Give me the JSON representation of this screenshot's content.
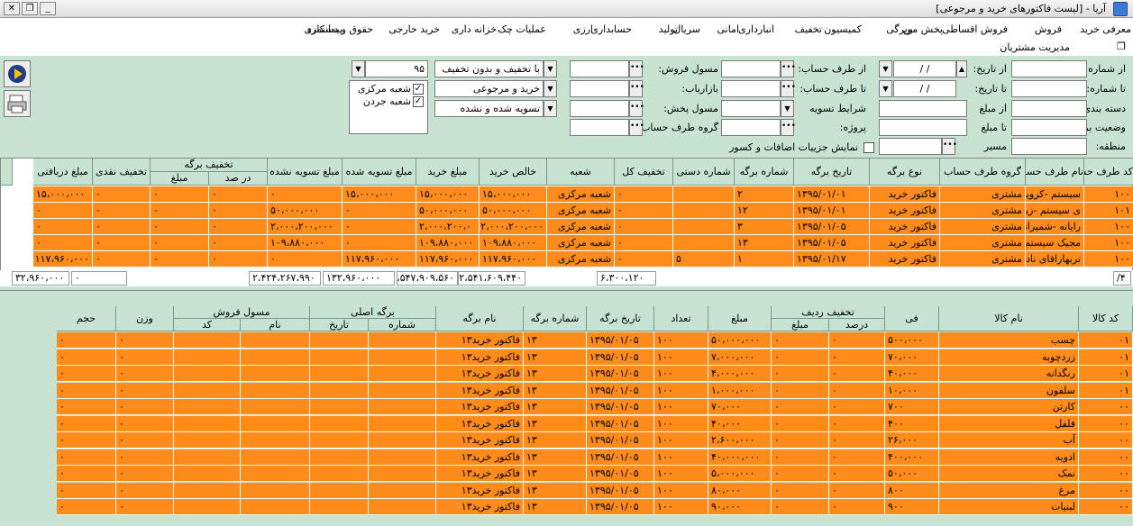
{
  "window": {
    "title": "آریا - [لیست فاکتورهای خرید و مرجوعی]",
    "min": "_",
    "restore": "❐",
    "close": "✕"
  },
  "menu": [
    "معرفی",
    "خرید",
    "فروش",
    "فروش اقساطی",
    "پخش مویرگی",
    "بن",
    "کمیسیون",
    "تخفیف",
    "انبارداری",
    "امانی",
    "سریال",
    "تولید",
    "حسابداری",
    "ارزی",
    "عملیات چک",
    "خزانه داری",
    "خرید خارجی",
    "حقوق و دستمزد",
    "پیمانکاری"
  ],
  "submenu": {
    "label": "مدیریت مشتریان",
    "icon": "❐"
  },
  "filters": {
    "from_number": "از شماره:",
    "to_number": "تا شماره:",
    "category": "دسته بندی:",
    "sheet_status": "وضعیت برگه",
    "region": "منطقه:",
    "from_date": "از تاریخ:",
    "to_date": "تا تاریخ:",
    "date_sep": "/   /",
    "from_amount": "از مبلغ",
    "to_amount": "تا مبلغ",
    "route": "مسیر",
    "from_account": "از طرف حساب:",
    "to_account": "تا طرف حساب:",
    "settlement": "شرایط تسویه",
    "project": "پروژه:",
    "sales_officer": "مسول فروش:",
    "marketer": "بازاریاب:",
    "dist_officer": "مسول پخش:",
    "account_group": "گروه طرف حساب",
    "show_details": "نمایش جزییات اضافات و کسور",
    "discount_sel": "با تخفیف و بدون تخفیف",
    "type_sel": "خرید و مرجوعی",
    "settle_sel": "تسویه شده و نشده",
    "year": "۹۵",
    "branch1": "شعبه مرکزی",
    "branch2": "شعبه جردن"
  },
  "top_headers": {
    "account_code": "کد طرف حساب",
    "account_name": "نام طرف حساب",
    "account_group": "گروه طرف حساب",
    "sheet_type": "نوع برگه",
    "sheet_date": "تاریخ برگه",
    "sheet_no": "شماره برگه",
    "manual_no": "شماره دستی",
    "total_discount": "تخفیف کل",
    "branch": "شعبه",
    "net_purchase": "خالص خرید",
    "purchase_amount": "مبلغ خرید",
    "settled_amount": "مبلغ تسویه شده",
    "unsettled_amount": "مبلغ تسویه نشده",
    "sheet_discount": "تخفیف برگه",
    "percent": "در صد",
    "amount": "مبلغ",
    "cash_discount": "تخفیف نقدی",
    "received_amount": "مبلغ دریافتی"
  },
  "top_rows": [
    {
      "code": "۱۰۰",
      "name": "سیستم -کرویی",
      "group": "مشتری",
      "type": "فاکتور خرید",
      "date": "۱۳۹۵/۰۱/۰۱",
      "no": "۲",
      "manual": "",
      "tdisc": "۰",
      "branch": "شعبه مرکزی",
      "net": "۱۵،۰۰۰،۰۰۰",
      "purchase": "۱۵،۰۰۰،۰۰۰",
      "settled": "۱۵،۰۰۰،۰۰۰",
      "unsettled": "۰",
      "pct": "۰",
      "amt": "۰",
      "cash": "۰",
      "received": "۱۵،۰۰۰،۰۰۰"
    },
    {
      "code": "۱۰۱",
      "name": "ی سیستم -زیان",
      "group": "مشتری",
      "type": "فاکتور خرید",
      "date": "۱۳۹۵/۰۱/۰۱",
      "no": "۱۲",
      "manual": "",
      "tdisc": "۰",
      "branch": "شعبه مرکزی",
      "net": "۵۰،۰۰۰،۰۰۰",
      "purchase": "۵۰،۰۰۰،۰۰۰",
      "settled": "۰",
      "unsettled": "۵۰،۰۰۰،۰۰۰",
      "pct": "۰",
      "amt": "۰",
      "cash": "۰",
      "received": "۰"
    },
    {
      "code": "۱۰۰",
      "name": "رایانه -شمیرانی",
      "group": "مشتری",
      "type": "فاکتور خرید",
      "date": "۱۳۹۵/۰۱/۰۵",
      "no": "۳",
      "manual": "",
      "tdisc": "۰",
      "branch": "شعبه مرکزی",
      "net": "۲،۰۰۰،۲۰۰،۰۰۰",
      "purchase": "۲،۰۰۰،۲۰۰،۰",
      "settled": "۰",
      "unsettled": "۲،۰۰۰،۲۰۰،۰۰۰",
      "pct": "۰",
      "amt": "۰",
      "cash": "۰",
      "received": "۰"
    },
    {
      "code": "۱۰۰",
      "name": "مجیک سیستم",
      "group": "مشتری",
      "type": "فاکتور خرید",
      "date": "۱۳۹۵/۰۱/۰۵",
      "no": "۱۳",
      "manual": "",
      "tdisc": "۰",
      "branch": "شعبه مرکزی",
      "net": "۱۰۹،۸۸۰،۰۰۰",
      "purchase": "۱۰۹،۸۸۰،۰۰۰",
      "settled": "۰",
      "unsettled": "۱۰۹،۸۸۰،۰۰۰",
      "pct": "۰",
      "amt": "۰",
      "cash": "۰",
      "received": "۰"
    },
    {
      "code": "۱۰۰",
      "name": "تربهارافای نادری",
      "group": "مشتری",
      "type": "فاکتور خرید",
      "date": "۱۳۹۵/۰۱/۱۷",
      "no": "۱",
      "manual": "۵",
      "tdisc": "۰",
      "branch": "شعبه مرکزی",
      "net": "۱۱۷،۹۶۰،۰۰۰",
      "purchase": "۱۱۷،۹۶۰،۰۰۰",
      "settled": "۱۱۷،۹۶۰،۰۰۰",
      "unsettled": "۰",
      "pct": "۰",
      "amt": "۰",
      "cash": "۰",
      "received": "۱۱۷،۹۶۰،۰۰۰"
    }
  ],
  "totals": {
    "count": "۴/",
    "tdisc": "۶،۳۰۰،۱۲۰",
    "net": "۲،۵۴۱،۶۰۹،۴۴۰",
    "purchase": "۲،۵۴۷،۹۰۹،۵۶۰",
    "settled": "۱۳۲،۹۶۰،۰۰۰",
    "unsettled": "۲،۴۲۴،۲۶۷،۹۹۰",
    "cash": "۰",
    "received": "۳۲،۹۶۰،۰۰۰"
  },
  "bottom_headers": {
    "code": "کد کالا",
    "name": "نام کالا",
    "fee": "فی",
    "row_discount": "تخفیف ردیف",
    "percent": "درصد",
    "amount_sub": "مبلغ",
    "amount": "مبلغ",
    "qty": "تعداد",
    "date": "تاریخ برگه",
    "no": "شماره برگه",
    "sheet_name": "نام برگه",
    "orig": "برگه اصلی",
    "orig_no": "شماره",
    "orig_date": "تاریخ",
    "sales": "مسول فروش",
    "sales_name": "نام",
    "sales_code": "کد",
    "weight": "وزن",
    "volume": "حجم"
  },
  "bottom_rows": [
    {
      "code": "۰۱",
      "name": "چسب",
      "fee": "۵۰۰،۰۰۰",
      "pct": "۰",
      "amt": "۰",
      "amount": "۵۰،۰۰۰،۰۰۰",
      "qty": "۱۰۰",
      "date": "۱۳۹۵/۰۱/۰۵",
      "no": "۱۳",
      "sname": "فاکتور خرید۱۳",
      "weight": "۰",
      "volume": "۰"
    },
    {
      "code": "۰۱",
      "name": "زردچوبه",
      "fee": "۷۰،۰۰۰",
      "pct": "۰",
      "amt": "۰",
      "amount": "۷،۰۰۰،۰۰۰",
      "qty": "۱۰۰",
      "date": "۱۳۹۵/۰۱/۰۵",
      "no": "۱۳",
      "sname": "فاکتور خرید۱۳",
      "weight": "۰",
      "volume": "۰"
    },
    {
      "code": "۰۱",
      "name": "رنگدانه",
      "fee": "۴۰،۰۰۰",
      "pct": "۰",
      "amt": "۰",
      "amount": "۴،۰۰۰،۰۰۰",
      "qty": "۱۰۰",
      "date": "۱۳۹۵/۰۱/۰۵",
      "no": "۱۳",
      "sname": "فاکتور خرید۱۳",
      "weight": "۰",
      "volume": "۰"
    },
    {
      "code": "۰۱",
      "name": "سلفون",
      "fee": "۱۰،۰۰۰",
      "pct": "۰",
      "amt": "۰",
      "amount": "۱،۰۰۰،۰۰۰",
      "qty": "۱۰۰",
      "date": "۱۳۹۵/۰۱/۰۵",
      "no": "۱۳",
      "sname": "فاکتور خرید۱۳",
      "weight": "۰",
      "volume": "۰"
    },
    {
      "code": "۰۰",
      "name": "کارتن",
      "fee": "۷۰۰",
      "pct": "۰",
      "amt": "۰",
      "amount": "۷۰،۰۰۰",
      "qty": "۱۰۰",
      "date": "۱۳۹۵/۰۱/۰۵",
      "no": "۱۳",
      "sname": "فاکتور خرید۱۳",
      "weight": "۰",
      "volume": "۰"
    },
    {
      "code": "۰۰",
      "name": "فلفل",
      "fee": "۴۰۰",
      "pct": "۰",
      "amt": "۰",
      "amount": "۴۰،۰۰۰",
      "qty": "۱۰۰",
      "date": "۱۳۹۵/۰۱/۰۵",
      "no": "۱۳",
      "sname": "فاکتور خرید۱۳",
      "weight": "۰",
      "volume": "۰"
    },
    {
      "code": "۰۰",
      "name": "آب",
      "fee": "۲۶،۰۰۰",
      "pct": "۰",
      "amt": "۰",
      "amount": "۲،۶۰۰،۰۰۰",
      "qty": "۱۰۰",
      "date": "۱۳۹۵/۰۱/۰۵",
      "no": "۱۳",
      "sname": "فاکتور خرید۱۳",
      "weight": "۰",
      "volume": "۰"
    },
    {
      "code": "۰۰",
      "name": "ادویه",
      "fee": "۴۰۰،۰۰۰",
      "pct": "۰",
      "amt": "۰",
      "amount": "۴۰،۰۰۰،۰۰۰",
      "qty": "۱۰۰",
      "date": "۱۳۹۵/۰۱/۰۵",
      "no": "۱۳",
      "sname": "فاکتور خرید۱۳",
      "weight": "۰",
      "volume": "۰"
    },
    {
      "code": "۰۰",
      "name": "نمک",
      "fee": "۵۰،۰۰۰",
      "pct": "۰",
      "amt": "۰",
      "amount": "۵،۰۰۰،۰۰۰",
      "qty": "۱۰۰",
      "date": "۱۳۹۵/۰۱/۰۵",
      "no": "۱۳",
      "sname": "فاکتور خرید۱۳",
      "weight": "۰",
      "volume": "۰"
    },
    {
      "code": "۰۰",
      "name": "مرغ",
      "fee": "۸۰۰",
      "pct": "۰",
      "amt": "۰",
      "amount": "۸۰،۰۰۰",
      "qty": "۱۰۰",
      "date": "۱۳۹۵/۰۱/۰۵",
      "no": "۱۳",
      "sname": "فاکتور خرید۱۳",
      "weight": "۰",
      "volume": "۰"
    },
    {
      "code": "۰۰",
      "name": "لبنیات",
      "fee": "۹۰۰",
      "pct": "۰",
      "amt": "۰",
      "amount": "۹۰،۰۰۰",
      "qty": "۱۰۰",
      "date": "۱۳۹۵/۰۱/۰۵",
      "no": "۱۳",
      "sname": "فاکتور خرید۱۳",
      "weight": "۰",
      "volume": "۰"
    }
  ]
}
